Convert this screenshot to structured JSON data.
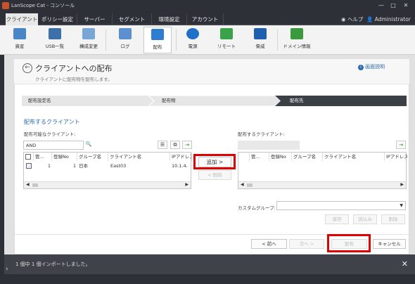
{
  "window": {
    "title": "LanScope Cat - コンソール",
    "min": "—",
    "max": "□",
    "close": "✕"
  },
  "menu": {
    "tabs": [
      "クライアント",
      "ポリシー設定",
      "サーバー",
      "セグメント",
      "環境設定",
      "アカウント"
    ],
    "help": "ヘルプ",
    "user": "Administrator"
  },
  "toolbar": [
    "資産",
    "USB一覧",
    "構成変更",
    "ログ",
    "配布",
    "電源",
    "リモート",
    "脅威",
    "ドメイン情報"
  ],
  "page": {
    "title": "クライアントへの配布",
    "subtitle": "クライアントに配布物を配布します。",
    "help": "画面説明"
  },
  "steps": [
    "配布設定名",
    "配布物",
    "配布先"
  ],
  "section": "配布するクライアント",
  "left": {
    "label": "配布可能なクライアント:",
    "search_value": "AND",
    "columns": [
      "管...",
      "登録No",
      "グループ名",
      "クライアント名",
      "IPアドレス"
    ],
    "row": [
      "1",
      "1",
      "日本",
      "East03",
      "10.1.4."
    ]
  },
  "right": {
    "label": "配布するクライアント:",
    "columns": [
      "管...",
      "登録No",
      "グループ名",
      "クライアント名",
      "IPアドレス"
    ]
  },
  "buttons": {
    "add": "追加  >",
    "remove": "<  削除",
    "save": "保存",
    "load": "読込み",
    "delete": "削除",
    "prev": "< 前へ",
    "next": "次へ >",
    "distribute": "配布",
    "cancel": "キャンセル"
  },
  "custom_group_label": "カスタムグループ:",
  "status": "1 個中 1 個インポートしました。"
}
